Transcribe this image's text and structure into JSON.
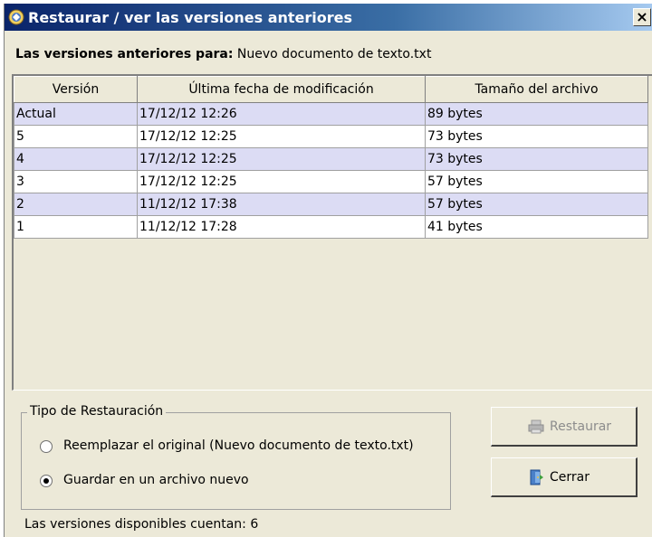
{
  "window": {
    "title": "Restaurar / ver las versiones anteriores",
    "close_label": "×"
  },
  "header": {
    "prefix": "Las versiones anteriores para:",
    "filename": "Nuevo documento de texto.txt"
  },
  "table": {
    "columns": [
      "Versión",
      "Última fecha de modificación",
      "Tamaño del archivo"
    ],
    "rows": [
      [
        "Actual",
        "17/12/12 12:26",
        "89 bytes"
      ],
      [
        "5",
        "17/12/12 12:25",
        "73 bytes"
      ],
      [
        "4",
        "17/12/12 12:25",
        "73 bytes"
      ],
      [
        "3",
        "17/12/12 12:25",
        "57 bytes"
      ],
      [
        "2",
        "11/12/12 17:38",
        "57 bytes"
      ],
      [
        "1",
        "11/12/12 17:28",
        "41 bytes"
      ]
    ]
  },
  "restore_type": {
    "legend": "Tipo de Restauración",
    "options": [
      {
        "label": "Reemplazar el original (Nuevo documento de texto.txt)",
        "selected": false
      },
      {
        "label": "Guardar en un archivo nuevo",
        "selected": true
      }
    ]
  },
  "buttons": {
    "restore_label": "Restaurar",
    "close_label": "Cerrar"
  },
  "footer": {
    "count_text": "Las versiones disponibles cuentan: 6"
  },
  "icons": {
    "title": "restore-globe-icon",
    "restore": "printer-icon",
    "close": "door-exit-icon"
  },
  "colors": {
    "titlebar": "#0a246a",
    "row_highlight": "#dcdcf4",
    "window_bg": "#ece9d8"
  }
}
